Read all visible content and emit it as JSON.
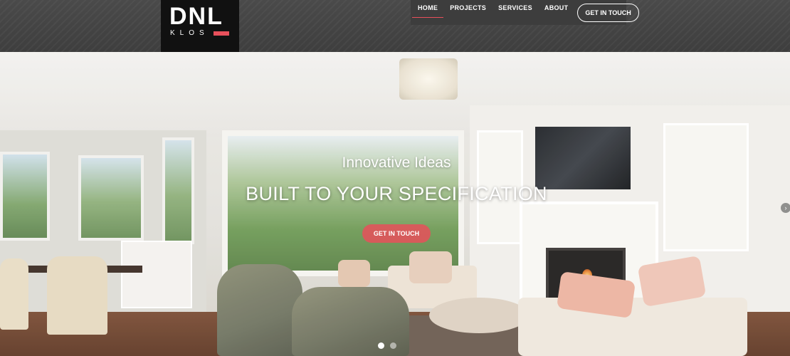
{
  "brand": {
    "logo_main": "DNL",
    "logo_sub": "KLOS",
    "accent_color": "#e8505b"
  },
  "nav": {
    "items": [
      {
        "label": "HOME",
        "active": true
      },
      {
        "label": "PROJECTS",
        "active": false
      },
      {
        "label": "SERVICES",
        "active": false
      },
      {
        "label": "ABOUT",
        "active": false
      }
    ],
    "cta_label": "GET IN TOUCH"
  },
  "hero": {
    "kicker": "Innovative Ideas",
    "title": "BUILT TO YOUR SPECIFICATION",
    "cta_label": "GET IN TOUCH",
    "next_icon": "chevron-right-icon",
    "slides_total": 2,
    "active_slide": 1
  }
}
